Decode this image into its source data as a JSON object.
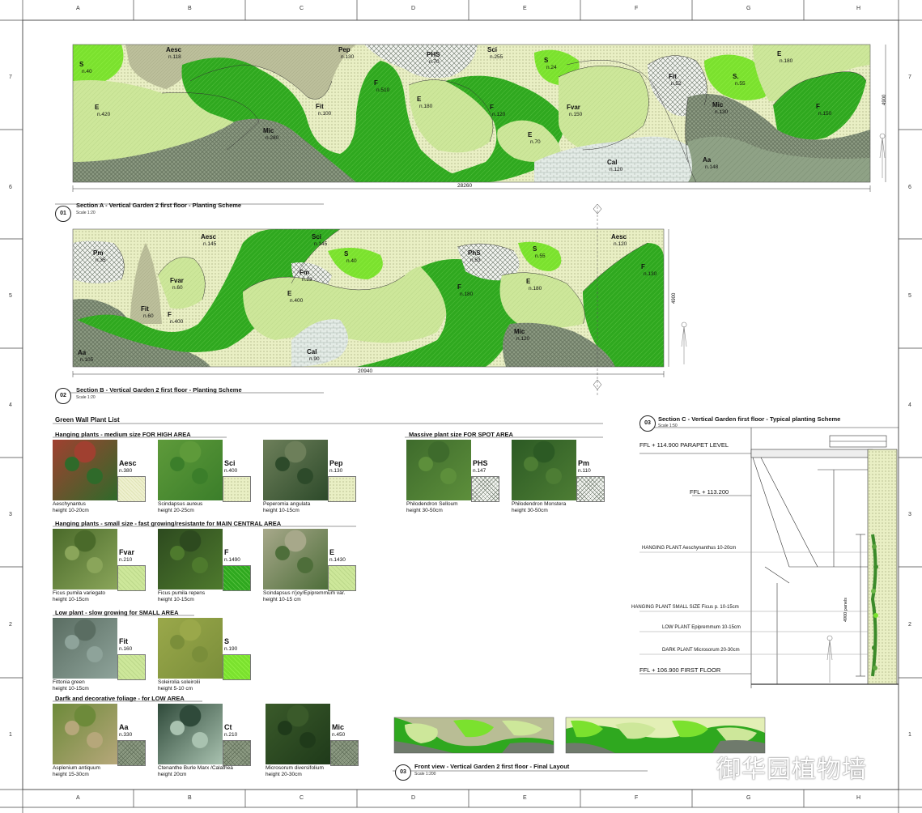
{
  "frame": {
    "columns": [
      "A",
      "B",
      "C",
      "D",
      "E",
      "F",
      "G",
      "H"
    ],
    "rows": [
      "7",
      "6",
      "5",
      "4",
      "3",
      "2",
      "1"
    ]
  },
  "section_a": {
    "num": "01",
    "title": "Section A  - Vertical Garden 2 first floor - Planting Scheme",
    "scale": "Scale 1:20",
    "width_dim": "28260",
    "height_dim": "4900",
    "zones": [
      {
        "code": "S",
        "count": "n.40"
      },
      {
        "code": "Aesc",
        "count": "n.118"
      },
      {
        "code": "Pep",
        "count": "n.130"
      },
      {
        "code": "PHS",
        "count": "n.70"
      },
      {
        "code": "Sci",
        "count": "n.255"
      },
      {
        "code": "S",
        "count": "n.24"
      },
      {
        "code": "E",
        "count": "n.180"
      },
      {
        "code": "E",
        "count": "n.420"
      },
      {
        "code": "Fit",
        "count": "n.100"
      },
      {
        "code": "F",
        "count": "n.510"
      },
      {
        "code": "E",
        "count": "n.180"
      },
      {
        "code": "F",
        "count": "n.120"
      },
      {
        "code": "Fvar",
        "count": "n.150"
      },
      {
        "code": "Fit",
        "count": "n.52"
      },
      {
        "code": "S.",
        "count": "n.55"
      },
      {
        "code": "Mic",
        "count": "n.280"
      },
      {
        "code": "E",
        "count": "n.70"
      },
      {
        "code": "Mic",
        "count": "n.130"
      },
      {
        "code": "F",
        "count": "n.150"
      },
      {
        "code": "Cal",
        "count": "n.120"
      },
      {
        "code": "Aa",
        "count": "n.148"
      }
    ]
  },
  "section_b": {
    "num": "02",
    "title": "Section B  - Vertical Garden 2 first floor - Planting Scheme",
    "scale": "Scale 1:20",
    "width_dim": "20940",
    "height_dim": "4900",
    "zones": [
      {
        "code": "Pm",
        "count": "n.35"
      },
      {
        "code": "Aesc",
        "count": "n.145"
      },
      {
        "code": "Sci",
        "count": "n.145"
      },
      {
        "code": "S",
        "count": "n.40"
      },
      {
        "code": "PhS",
        "count": "n.53"
      },
      {
        "code": "S",
        "count": "n.55"
      },
      {
        "code": "Aesc",
        "count": "n.120"
      },
      {
        "code": "Fvar",
        "count": "n.60"
      },
      {
        "code": "Fm",
        "count": "n.23"
      },
      {
        "code": "F",
        "count": "n.130"
      },
      {
        "code": "Fit",
        "count": "n.60"
      },
      {
        "code": "F",
        "count": "n.400"
      },
      {
        "code": "E",
        "count": "n.400"
      },
      {
        "code": "F",
        "count": "n.180"
      },
      {
        "code": "E",
        "count": "n.180"
      },
      {
        "code": "Aa",
        "count": "n.105"
      },
      {
        "code": "Cal",
        "count": "n.90"
      },
      {
        "code": "Mic",
        "count": "n.120"
      }
    ]
  },
  "plant_list": {
    "title": "Green Wall Plant List",
    "groups": [
      {
        "title": "Hanging plants - medium size FOR HIGH AREA",
        "items": [
          {
            "code": "Aesc",
            "count": "n.380",
            "name": "Aeschynantus",
            "height": "height 10-20cm"
          },
          {
            "code": "Sci",
            "count": "n.400",
            "name": "Scindapsus aureus",
            "height": "height 20-25cm"
          },
          {
            "code": "Pep",
            "count": "n.130",
            "name": "Peperomia angulata",
            "height": "height 10-15cm"
          }
        ]
      },
      {
        "title": "Massive plant size FOR SPOT AREA",
        "items": [
          {
            "code": "PHS",
            "count": "n.147",
            "name": "Philodendron Selloum",
            "height": "height 30-50cm"
          },
          {
            "code": "Pm",
            "count": "n.110",
            "name": "Philodendron Monstera",
            "height": "height 30-50cm"
          }
        ]
      },
      {
        "title": "Hanging plants - small size - fast growing/resistante for MAIN CENTRAL AREA",
        "items": [
          {
            "code": "Fvar",
            "count": "n.210",
            "name": "Ficus pumila variegato",
            "height": "height 10-15cm"
          },
          {
            "code": "F",
            "count": "n.1490",
            "name": "Ficus pumila repens",
            "height": "height 10-15cm"
          },
          {
            "code": "E",
            "count": "n.1430",
            "name": "Scindapsus n'joy/Epipremmum var.",
            "height": "height 10-15 cm"
          }
        ]
      },
      {
        "title": "Low plant - slow growing  for SMALL AREA",
        "items": [
          {
            "code": "Fit",
            "count": "n.160",
            "name": "Fittonia green",
            "height": "height 10-15cm"
          },
          {
            "code": "S",
            "count": "n.190",
            "name": "Soleirolia soleirolii",
            "height": "height 5-10 cm"
          }
        ]
      },
      {
        "title": "Darfk and decorative foliage - for LOW AREA",
        "items": [
          {
            "code": "Aa",
            "count": "n.330",
            "name": "Asplenium antiquum",
            "height": "height 15-30cm"
          },
          {
            "code": "Ct",
            "count": "n.210",
            "name": "Ctenanthe Burle Marx /Calathea",
            "height": "height 20cm"
          },
          {
            "code": "Mic",
            "count": "n.450",
            "name": "Microsorum diversifolium",
            "height": "height 20-30cm"
          }
        ]
      }
    ]
  },
  "section_c": {
    "num": "03",
    "title": "Section C  - Vertical Garden first floor - Typical planting Scheme",
    "scale": "Scale 1:50",
    "levels": [
      "FFL + 114.900 PARAPET LEVEL",
      "FFL + 113.200",
      "FFL + 106.900 FIRST FLOOR"
    ],
    "notes": [
      "HANGING PLANT Aeschynanthus 10-20cm",
      "HANGING PLANT SMALL SIZE  Ficus p. 10-15cm",
      "LOW PLANT Epipremmum 10-15cm",
      "DARK PLANT Microsorum 20-30cm"
    ],
    "dim": "4900 panels"
  },
  "front_view": {
    "num": "03",
    "title": "Front view  - Vertical Garden 2 first floor - Final Layout",
    "scale": "Scale 1:200"
  },
  "watermark": "御华园植物墙",
  "colors": {
    "bright_green": "#2fa81f",
    "lime": "#7be12e",
    "light_green": "#cde79a",
    "pale_green": "#e3efb6",
    "khaki": "#b9bd95",
    "grey_green": "#8d9d84",
    "light_grey": "#dfe5dd"
  }
}
